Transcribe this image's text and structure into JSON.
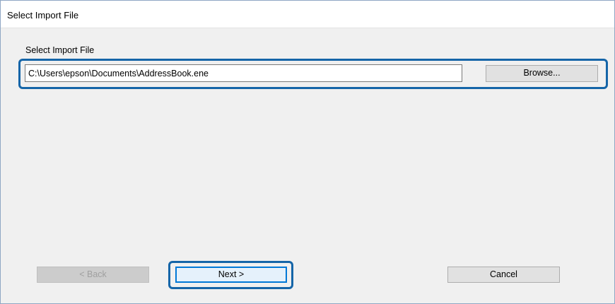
{
  "window": {
    "title": "Select Import File"
  },
  "file_section": {
    "label": "Select Import File",
    "path_value": "C:\\Users\\epson\\Documents\\AddressBook.ene",
    "browse_label": "Browse..."
  },
  "footer": {
    "back_label": "< Back",
    "back_enabled": false,
    "next_label": "Next >",
    "cancel_label": "Cancel"
  },
  "colors": {
    "highlight": "#1565a8",
    "focus_border": "#0078d7",
    "button_face": "#e1e1e1",
    "window_bg": "#f0f0f0"
  }
}
